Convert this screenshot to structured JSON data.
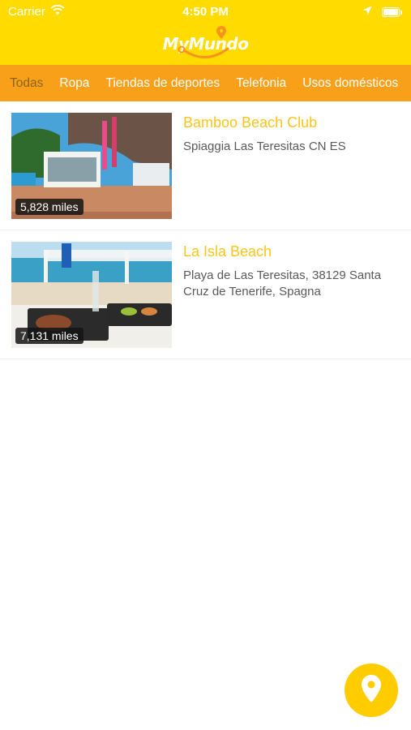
{
  "status_bar": {
    "carrier": "Carrier",
    "time": "4:50 PM"
  },
  "header": {
    "logo_text": "MyMundo"
  },
  "tabs": [
    {
      "label": "Todas",
      "active": true
    },
    {
      "label": "Ropa"
    },
    {
      "label": "Tiendas de deportes"
    },
    {
      "label": "Telefonia"
    },
    {
      "label": "Usos domésticos"
    }
  ],
  "places": [
    {
      "name": "Bamboo Beach Club",
      "address": "Spiaggia Las Teresitas CN ES",
      "distance": "5,828 miles"
    },
    {
      "name": "La Isla Beach",
      "address": "Playa de Las Teresitas, 38129 Santa Cruz de Tenerife, Spagna",
      "distance": "7,131 miles"
    }
  ],
  "colors": {
    "header": "#FFDB00",
    "tabs": "#F9A01B",
    "title": "#F8C51C",
    "fab": "#FFCC00"
  },
  "icons": {
    "wifi": "wifi-icon",
    "location_arrow": "location-arrow-icon",
    "battery": "battery-icon",
    "map_pin": "map-pin-icon"
  }
}
